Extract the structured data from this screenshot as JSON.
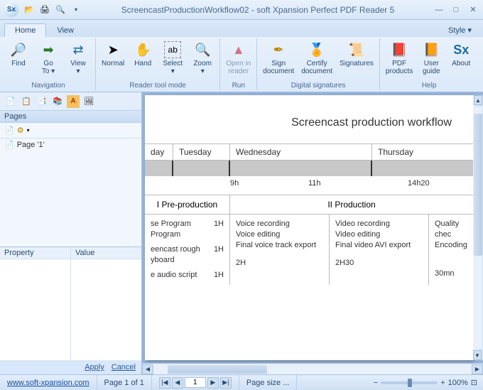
{
  "titlebar": {
    "logo_text": "Sx",
    "title": "ScreencastProductionWorkflow02 - soft Xpansion Perfect PDF Reader 5"
  },
  "tabs": {
    "home": "Home",
    "view": "View",
    "style": "Style ▾"
  },
  "ribbon": {
    "navigation": {
      "name": "Navigation",
      "find": "Find",
      "goto": "Go\nTo ▾",
      "view": "View\n▾"
    },
    "reader": {
      "name": "Reader tool mode",
      "normal": "Normal",
      "hand": "Hand",
      "select": "Select\n▾",
      "zoom": "Zoom\n▾"
    },
    "run": {
      "name": "Run",
      "open": "Open in\nreader"
    },
    "sigs": {
      "name": "Digital signatures",
      "sign": "Sign\ndocument",
      "certify": "Certify\ndocument",
      "signatures": "Signatures"
    },
    "help": {
      "name": "Help",
      "pdf": "PDF\nproducts",
      "user": "User\nguide",
      "about": "About"
    }
  },
  "pages": {
    "header": "Pages",
    "item": "Page '1'",
    "prop_header": "Property",
    "val_header": "Value",
    "apply": "Apply",
    "cancel": "Cancel"
  },
  "document": {
    "title": "Screencast production workflow",
    "days": {
      "mon": "day",
      "tue": "Tuesday",
      "wed": "Wednesday",
      "thu": "Thursday"
    },
    "durations": {
      "d1": "9h",
      "d2": "11h",
      "d3": "14h20"
    },
    "phases": {
      "p1": "I Pre-production",
      "p2": "II Production"
    },
    "cells": {
      "c1a": "se Program",
      "c1a_t": "1H",
      "c1b": "Program",
      "c1c": "eencast rough",
      "c1c_t": "1H",
      "c1d": "yboard",
      "c1e": "e audio script",
      "c1e_t": "1H",
      "c2a": "Voice recording",
      "c2b": "Voice editing",
      "c2c": "Final voice track export",
      "c2d": "2H",
      "c3a": "Video recording",
      "c3b": "Video editing",
      "c3c": "Final video AVI export",
      "c3d": "2H30",
      "c4a": "Quality chec",
      "c4b": "Encoding",
      "c4c": "30mn"
    }
  },
  "status": {
    "url": "www.soft-xpansion.com",
    "page": "Page 1 of 1",
    "cur": "1",
    "pagesize": "Page size ...",
    "zoom": "100%"
  }
}
